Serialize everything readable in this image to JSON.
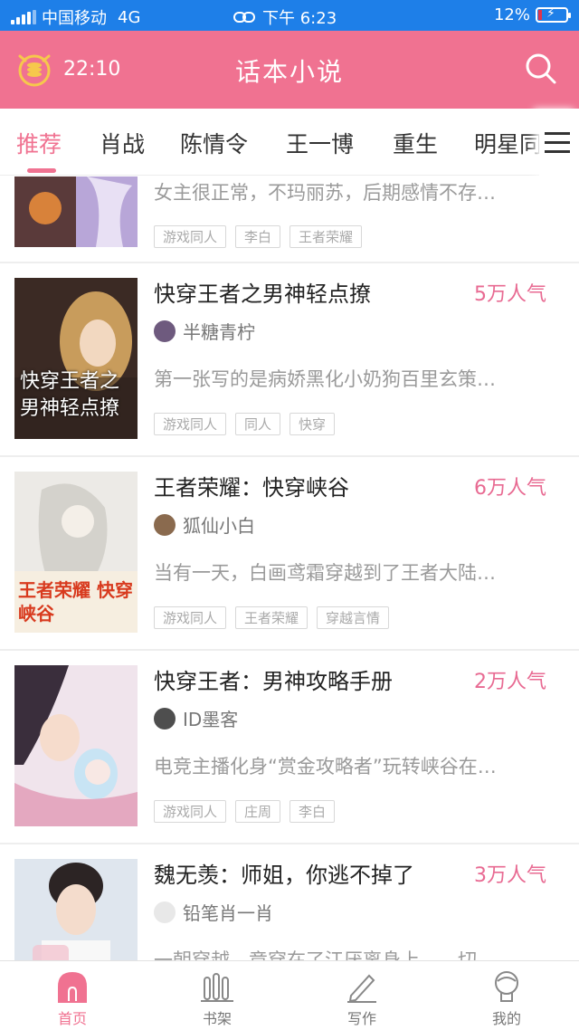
{
  "status_bar": {
    "carrier": "中国移动",
    "network": "4G",
    "time": "下午 6:23",
    "battery": "12%"
  },
  "header": {
    "timer": "22:10",
    "title": "话本小说"
  },
  "tabs": [
    {
      "label": "推荐",
      "active": true
    },
    {
      "label": "肖战"
    },
    {
      "label": "陈情令"
    },
    {
      "label": "王一博"
    },
    {
      "label": "重生"
    },
    {
      "label": "明星同"
    }
  ],
  "books": [
    {
      "title": "",
      "popularity": "",
      "author": "",
      "desc": "女主很正常，不玛丽苏，后期感情不存…",
      "tags": [
        "游戏同人",
        "李白",
        "王者荣耀"
      ]
    },
    {
      "title": "快穿王者之男神轻点撩",
      "popularity": "5万人气",
      "author": "半糖青柠",
      "desc": "第一张写的是病娇黑化小奶狗百里玄策…",
      "tags": [
        "游戏同人",
        "同人",
        "快穿"
      ],
      "cover_text": "快穿王者之男神轻点撩"
    },
    {
      "title": "王者荣耀：快穿峡谷",
      "popularity": "6万人气",
      "author": "狐仙小白",
      "desc": "当有一天，白画鸢霜穿越到了王者大陆…",
      "tags": [
        "游戏同人",
        "王者荣耀",
        "穿越言情"
      ],
      "cover_text": "王者荣耀 快穿峡谷"
    },
    {
      "title": "快穿王者：男神攻略手册",
      "popularity": "2万人气",
      "author": "ID墨客",
      "desc": "电竞主播化身“赏金攻略者”玩转峡谷在…",
      "tags": [
        "游戏同人",
        "庄周",
        "李白"
      ]
    },
    {
      "title": "魏无羡：师姐，你逃不掉了",
      "popularity": "3万人气",
      "author": "铅笔肖一肖",
      "desc": "一朝穿越，竟穿在了江厌离身上……切",
      "tags": []
    }
  ],
  "bottom_nav": [
    {
      "label": "首页",
      "icon": "home-icon",
      "active": true
    },
    {
      "label": "书架",
      "icon": "bookshelf-icon"
    },
    {
      "label": "写作",
      "icon": "pen-icon"
    },
    {
      "label": "我的",
      "icon": "profile-icon"
    }
  ],
  "colors": {
    "status_bar": "#1e7fe8",
    "header": "#f07291",
    "accent": "#f07291",
    "popularity": "#e86a92"
  }
}
